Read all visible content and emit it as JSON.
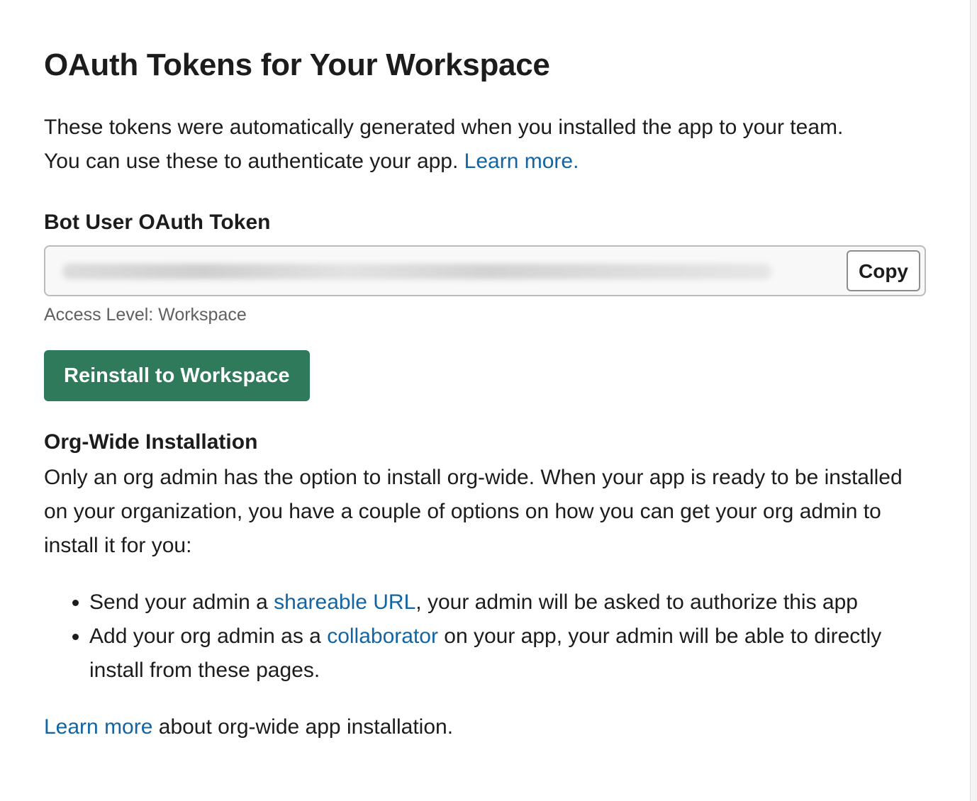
{
  "page": {
    "title": "OAuth Tokens for Your Workspace",
    "intro_line1": "These tokens were automatically generated when you installed the app to your team.",
    "intro_line2": "You can use these to authenticate your app. ",
    "intro_link": "Learn more."
  },
  "token": {
    "label": "Bot User OAuth Token",
    "value_display": "",
    "copy_label": "Copy",
    "access_level": "Access Level: Workspace"
  },
  "actions": {
    "reinstall_label": "Reinstall to Workspace"
  },
  "org_wide": {
    "heading": "Org-Wide Installation",
    "description": "Only an org admin has the option to install org-wide. When your app is ready to be installed on your organization, you have a couple of options on how you can get your org admin to install it for you:",
    "bullets": [
      {
        "before": "Send your admin a ",
        "link": "shareable URL",
        "after": ", your admin will be asked to authorize this app"
      },
      {
        "before": "Add your org admin as a ",
        "link": "collaborator",
        "after": " on your app, your admin will be able to directly install from these pages."
      }
    ],
    "footer_link": "Learn more",
    "footer_text": " about org-wide app installation."
  },
  "colors": {
    "accent_green": "#2f7a5b",
    "link_blue": "#1264a3"
  }
}
